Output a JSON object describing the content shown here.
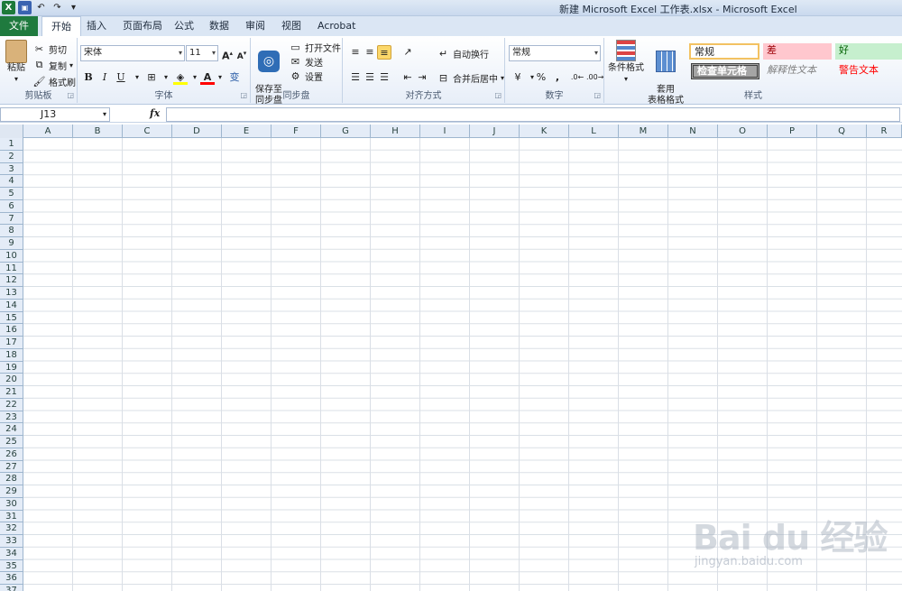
{
  "window": {
    "title": "新建 Microsoft Excel 工作表.xlsx - Microsoft Excel"
  },
  "tabs": [
    "文件",
    "开始",
    "插入",
    "页面布局",
    "公式",
    "数据",
    "审阅",
    "视图",
    "Acrobat"
  ],
  "clipboard": {
    "paste": "粘贴",
    "cut": "剪切",
    "copy": "复制",
    "format_painter": "格式刷",
    "label": "剪贴板"
  },
  "font": {
    "name": "宋体",
    "size": "11",
    "bold": "B",
    "italic": "I",
    "underline": "U",
    "label": "字体"
  },
  "sync": {
    "save_to": "保存至\n同步盘",
    "open_file": "打开文件",
    "send": "发送",
    "settings": "设置",
    "label": "同步盘"
  },
  "alignment": {
    "wrap": "自动换行",
    "merge": "合并后居中",
    "label": "对齐方式"
  },
  "number": {
    "format": "常规",
    "percent": "%",
    "comma": ",",
    "label": "数字"
  },
  "styles": {
    "conditional": "条件格式",
    "table_format": "套用\n表格格式",
    "normal": "常规",
    "bad": "差",
    "good": "好",
    "check_cell": "检查单元格",
    "explanatory": "解释性文本",
    "warning": "警告文本",
    "label": "样式"
  },
  "formula_bar": {
    "name_box": "J13",
    "fx": "fx"
  },
  "columns": [
    "A",
    "B",
    "C",
    "D",
    "E",
    "F",
    "G",
    "H",
    "I",
    "J",
    "K",
    "L",
    "M",
    "N",
    "O",
    "P",
    "Q",
    "R"
  ],
  "rows": [
    "1",
    "2",
    "3",
    "4",
    "5",
    "6",
    "7",
    "8",
    "9",
    "10",
    "11",
    "12",
    "13",
    "14",
    "15",
    "16",
    "17",
    "18",
    "19",
    "20",
    "21",
    "22",
    "23",
    "24",
    "25",
    "26",
    "27",
    "28",
    "29",
    "30",
    "31",
    "32",
    "33",
    "34",
    "35",
    "36",
    "37"
  ],
  "watermark": {
    "brand": "Bai du 经验",
    "url": "jingyan.baidu.com"
  },
  "colors": {
    "file_tab": "#1f7a3e",
    "bad_bg": "#ffc7ce",
    "bad_fg": "#9c0006",
    "good_bg": "#c6efce",
    "good_fg": "#006100",
    "warning_fg": "#ff0000"
  }
}
